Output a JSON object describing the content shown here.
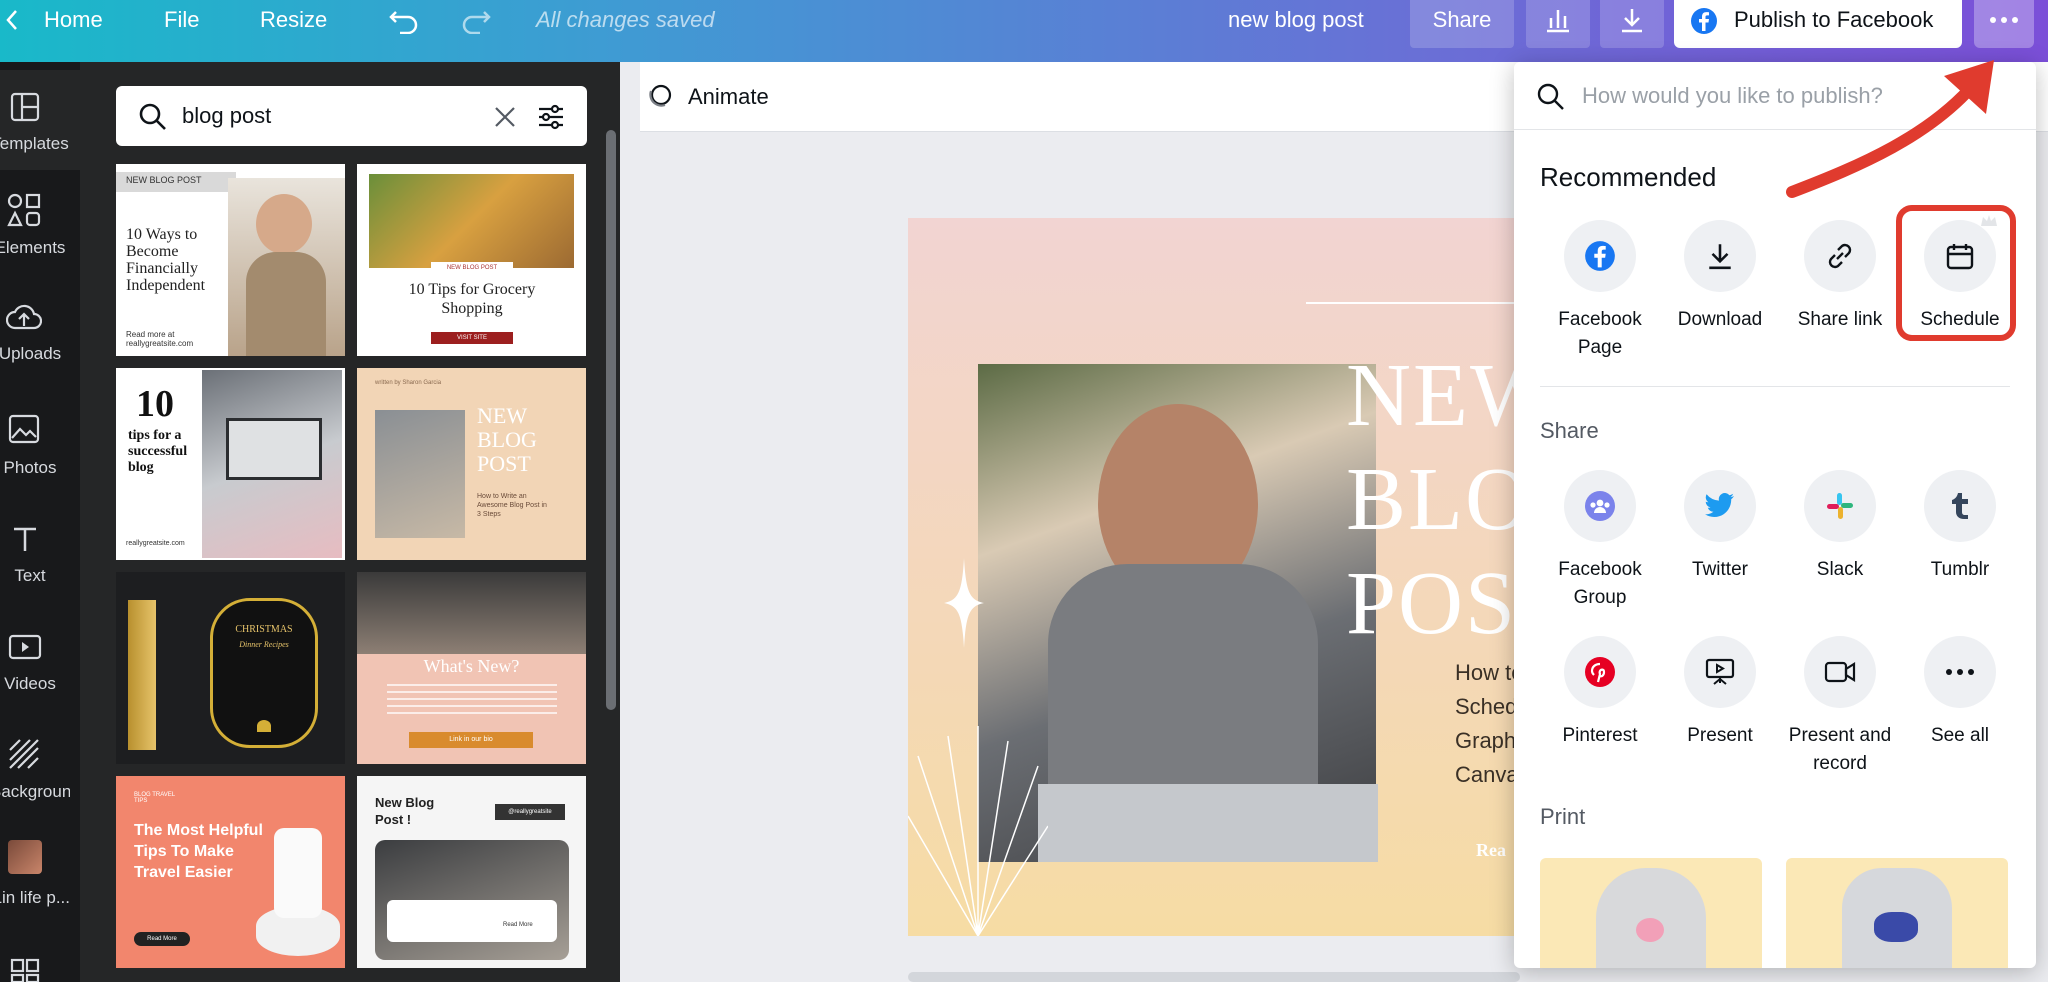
{
  "topbar": {
    "home": "Home",
    "file": "File",
    "resize": "Resize",
    "saved_status": "All changes saved",
    "doc_title": "new blog post",
    "share": "Share",
    "publish": "Publish to Facebook"
  },
  "nav": [
    {
      "label": "Templates",
      "icon": "templates-icon"
    },
    {
      "label": "Elements",
      "icon": "elements-icon"
    },
    {
      "label": "Uploads",
      "icon": "uploads-icon"
    },
    {
      "label": "Photos",
      "icon": "photos-icon"
    },
    {
      "label": "Text",
      "icon": "text-icon"
    },
    {
      "label": "Videos",
      "icon": "videos-icon"
    },
    {
      "label": "Background",
      "icon": "background-icon"
    },
    {
      "label": "Lin life p...",
      "icon": "folder-thumbnail-icon"
    }
  ],
  "panel": {
    "search_value": "blog post",
    "thumbs": [
      {
        "tag": "NEW BLOG POST",
        "title": "10 Ways to Become Financially Independent",
        "foot": "Read more at reallygreatsite.com"
      },
      {
        "tag": "NEW BLOG POST",
        "title": "10 Tips for Grocery Shopping",
        "foot": "VISIT SITE"
      },
      {
        "tag": "10",
        "title": "tips for a successful blog",
        "foot": "reallygreatsite.com"
      },
      {
        "tag": "written by Sharon Garcia",
        "title": "NEW BLOG POST",
        "foot": "How to Write an Awesome Blog Post in 3 Steps"
      },
      {
        "tag": "CHRISTMAS",
        "title": "Dinner Recipes",
        "foot": ""
      },
      {
        "tag": "",
        "title": "What's New?",
        "foot": "Link in our bio"
      },
      {
        "tag": "BLOG TRAVEL TIPS",
        "title": "The Most Helpful Tips To Make Travel Easier",
        "foot": "Read More"
      },
      {
        "tag": "@reallygreatsite",
        "title": "New Blog Post !",
        "foot": "Read More"
      }
    ]
  },
  "editor": {
    "animate": "Animate",
    "art_title": [
      "NEW",
      "BLOG",
      "POST"
    ],
    "art_lines": [
      "How to",
      "Sched",
      "Graph",
      "Canva"
    ],
    "art_foot": "Rea"
  },
  "popover": {
    "search_placeholder": "How would you like to publish?",
    "recommended_title": "Recommended",
    "recommended": [
      {
        "label": "Facebook Page",
        "icon": "facebook-icon"
      },
      {
        "label": "Download",
        "icon": "download-icon"
      },
      {
        "label": "Share link",
        "icon": "link-icon"
      },
      {
        "label": "Schedule",
        "icon": "calendar-icon"
      }
    ],
    "share_title": "Share",
    "share": [
      {
        "label": "Facebook Group",
        "icon": "facebook-group-icon"
      },
      {
        "label": "Twitter",
        "icon": "twitter-icon"
      },
      {
        "label": "Slack",
        "icon": "slack-icon"
      },
      {
        "label": "Tumblr",
        "icon": "tumblr-icon"
      },
      {
        "label": "Pinterest",
        "icon": "pinterest-icon"
      },
      {
        "label": "Present",
        "icon": "present-icon"
      },
      {
        "label": "Present and record",
        "icon": "record-icon"
      },
      {
        "label": "See all",
        "icon": "more-icon"
      }
    ],
    "print_title": "Print"
  },
  "colors": {
    "accent": "#7b4fd8",
    "highlight": "#e03b2e",
    "facebook": "#1877f2"
  }
}
